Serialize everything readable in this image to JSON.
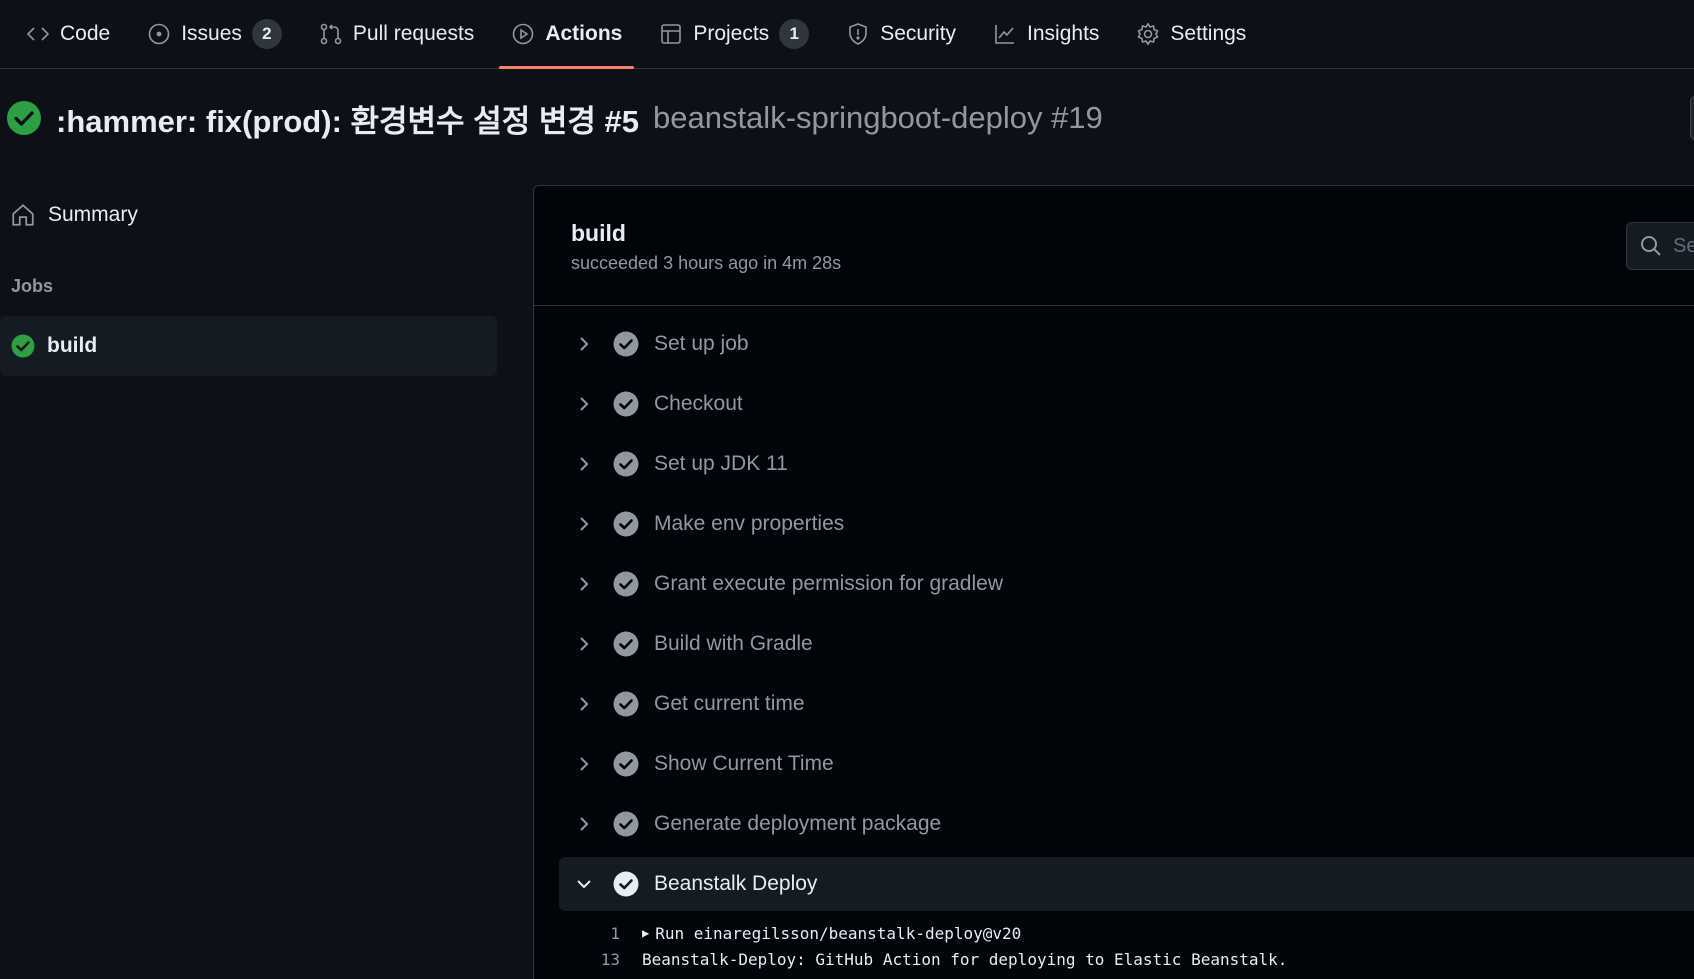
{
  "nav": {
    "tabs": [
      {
        "label": "Code",
        "icon": "code-icon"
      },
      {
        "label": "Issues",
        "icon": "issue-icon",
        "count": "2"
      },
      {
        "label": "Pull requests",
        "icon": "pull-request-icon"
      },
      {
        "label": "Actions",
        "icon": "play-icon",
        "selected": true
      },
      {
        "label": "Projects",
        "icon": "table-icon",
        "count": "1"
      },
      {
        "label": "Security",
        "icon": "shield-icon"
      },
      {
        "label": "Insights",
        "icon": "graph-icon"
      },
      {
        "label": "Settings",
        "icon": "gear-icon"
      }
    ]
  },
  "run": {
    "title": ":hammer: fix(prod): 환경변수 설정 변경 #5",
    "workflow": "beanstalk-springboot-deploy #19",
    "status_color": "#2ea043"
  },
  "sidebar": {
    "summary_label": "Summary",
    "jobs_heading": "Jobs",
    "job_label": "build"
  },
  "job": {
    "title": "build",
    "meta": "succeeded 3 hours ago in 4m 28s",
    "search_placeholder": "Se"
  },
  "steps": [
    {
      "label": "Set up job"
    },
    {
      "label": "Checkout"
    },
    {
      "label": "Set up JDK 11"
    },
    {
      "label": "Make env properties"
    },
    {
      "label": "Grant execute permission for gradlew"
    },
    {
      "label": "Build with Gradle"
    },
    {
      "label": "Get current time"
    },
    {
      "label": "Show Current Time"
    },
    {
      "label": "Generate deployment package"
    },
    {
      "label": "Beanstalk Deploy",
      "expanded": true
    }
  ],
  "log": [
    {
      "line": "1",
      "text": "Run einaregilsson/beanstalk-deploy@v20",
      "collapsible": true
    },
    {
      "line": "13",
      "text": "Beanstalk-Deploy: GitHub Action for deploying to Elastic Beanstalk."
    }
  ],
  "colors": {
    "accent": "#f78166",
    "success": "#2ea043",
    "muted_check": "#9198a1"
  }
}
